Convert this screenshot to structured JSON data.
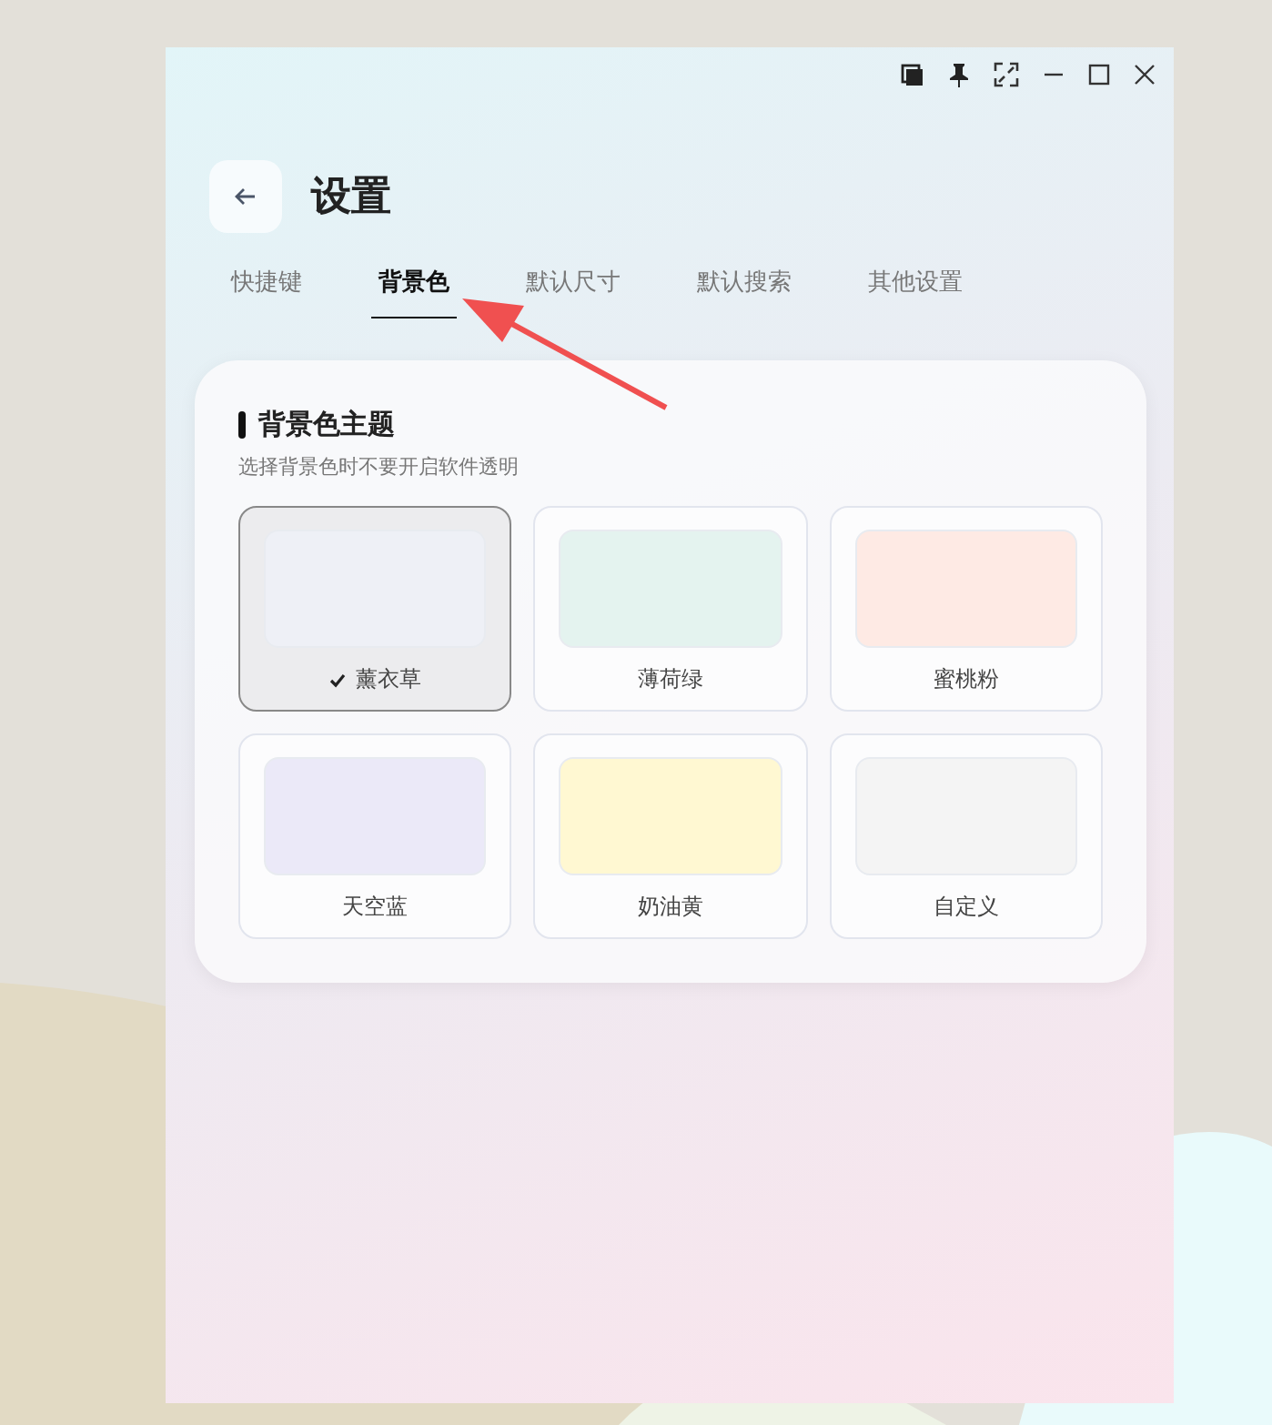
{
  "title": "设置",
  "tabs": [
    {
      "label": "快捷键",
      "selected": false
    },
    {
      "label": "背景色",
      "selected": true
    },
    {
      "label": "默认尺寸",
      "selected": false
    },
    {
      "label": "默认搜索",
      "selected": false
    },
    {
      "label": "其他设置",
      "selected": false
    }
  ],
  "section": {
    "title": "背景色主题",
    "subtitle": "选择背景色时不要开启软件透明"
  },
  "themes": [
    {
      "label": "薰衣草",
      "selected": true,
      "color": "#eef0f6"
    },
    {
      "label": "薄荷绿",
      "selected": false,
      "color": "#e4f3ef"
    },
    {
      "label": "蜜桃粉",
      "selected": false,
      "color": "#feeae4"
    },
    {
      "label": "天空蓝",
      "selected": false,
      "color": "#ebe9f8"
    },
    {
      "label": "奶油黄",
      "selected": false,
      "color": "#fff8d2"
    },
    {
      "label": "自定义",
      "selected": false,
      "color": "#f4f4f4"
    }
  ]
}
